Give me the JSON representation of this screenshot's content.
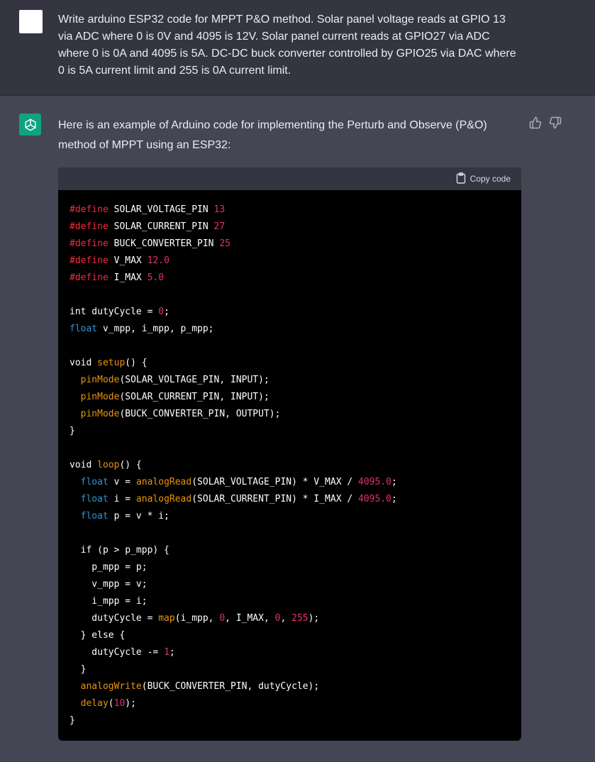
{
  "user": {
    "message": "Write arduino ESP32 code for MPPT P&O method. Solar panel voltage reads at GPIO 13 via ADC where 0 is 0V and 4095 is 12V. Solar panel current reads at GPIO27 via ADC where 0 is 0A and 4095 is 5A. DC-DC buck converter controlled by GPIO25 via DAC where 0 is 5A current limit and 255 is 0A current limit."
  },
  "assistant": {
    "intro": "Here is an example of Arduino code for implementing the Perturb and Observe (P&O) method of MPPT using an ESP32:",
    "avatar_icon": "openai-logo-icon",
    "feedback_icons": [
      "thumbs-up-icon",
      "thumbs-down-icon"
    ]
  },
  "code_block": {
    "copy_label": "Copy code",
    "copy_icon": "clipboard-icon",
    "lines": [
      [
        [
          "kw",
          "#define"
        ],
        [
          "p",
          " SOLAR_VOLTAGE_PIN "
        ],
        [
          "n",
          "13"
        ]
      ],
      [
        [
          "kw",
          "#define"
        ],
        [
          "p",
          " SOLAR_CURRENT_PIN "
        ],
        [
          "n",
          "27"
        ]
      ],
      [
        [
          "kw",
          "#define"
        ],
        [
          "p",
          " BUCK_CONVERTER_PIN "
        ],
        [
          "n",
          "25"
        ]
      ],
      [
        [
          "kw",
          "#define"
        ],
        [
          "p",
          " V_MAX "
        ],
        [
          "n",
          "12.0"
        ]
      ],
      [
        [
          "kw",
          "#define"
        ],
        [
          "p",
          " I_MAX "
        ],
        [
          "n",
          "5.0"
        ]
      ],
      [],
      [
        [
          "p",
          "int dutyCycle = "
        ],
        [
          "n",
          "0"
        ],
        [
          "p",
          ";"
        ]
      ],
      [
        [
          "t",
          "float"
        ],
        [
          "p",
          " v_mpp, i_mpp, p_mpp;"
        ]
      ],
      [],
      [
        [
          "p",
          "void "
        ],
        [
          "f",
          "setup"
        ],
        [
          "p",
          "() {"
        ]
      ],
      [
        [
          "p",
          "  "
        ],
        [
          "f",
          "pinMode"
        ],
        [
          "p",
          "(SOLAR_VOLTAGE_PIN, INPUT);"
        ]
      ],
      [
        [
          "p",
          "  "
        ],
        [
          "f",
          "pinMode"
        ],
        [
          "p",
          "(SOLAR_CURRENT_PIN, INPUT);"
        ]
      ],
      [
        [
          "p",
          "  "
        ],
        [
          "f",
          "pinMode"
        ],
        [
          "p",
          "(BUCK_CONVERTER_PIN, OUTPUT);"
        ]
      ],
      [
        [
          "p",
          "}"
        ]
      ],
      [],
      [
        [
          "p",
          "void "
        ],
        [
          "f",
          "loop"
        ],
        [
          "p",
          "() {"
        ]
      ],
      [
        [
          "p",
          "  "
        ],
        [
          "t",
          "float"
        ],
        [
          "p",
          " v = "
        ],
        [
          "f",
          "analogRead"
        ],
        [
          "p",
          "(SOLAR_VOLTAGE_PIN) * V_MAX / "
        ],
        [
          "n",
          "4095.0"
        ],
        [
          "p",
          ";"
        ]
      ],
      [
        [
          "p",
          "  "
        ],
        [
          "t",
          "float"
        ],
        [
          "p",
          " i = "
        ],
        [
          "f",
          "analogRead"
        ],
        [
          "p",
          "(SOLAR_CURRENT_PIN) * I_MAX / "
        ],
        [
          "n",
          "4095.0"
        ],
        [
          "p",
          ";"
        ]
      ],
      [
        [
          "p",
          "  "
        ],
        [
          "t",
          "float"
        ],
        [
          "p",
          " p = v * i;"
        ]
      ],
      [],
      [
        [
          "p",
          "  if (p > p_mpp) {"
        ]
      ],
      [
        [
          "p",
          "    p_mpp = p;"
        ]
      ],
      [
        [
          "p",
          "    v_mpp = v;"
        ]
      ],
      [
        [
          "p",
          "    i_mpp = i;"
        ]
      ],
      [
        [
          "p",
          "    dutyCycle = "
        ],
        [
          "f",
          "map"
        ],
        [
          "p",
          "(i_mpp, "
        ],
        [
          "n",
          "0"
        ],
        [
          "p",
          ", I_MAX, "
        ],
        [
          "n",
          "0"
        ],
        [
          "p",
          ", "
        ],
        [
          "n",
          "255"
        ],
        [
          "p",
          ");"
        ]
      ],
      [
        [
          "p",
          "  } else {"
        ]
      ],
      [
        [
          "p",
          "    dutyCycle -= "
        ],
        [
          "n",
          "1"
        ],
        [
          "p",
          ";"
        ]
      ],
      [
        [
          "p",
          "  }"
        ]
      ],
      [
        [
          "p",
          "  "
        ],
        [
          "f",
          "analogWrite"
        ],
        [
          "p",
          "(BUCK_CONVERTER_PIN, dutyCycle);"
        ]
      ],
      [
        [
          "p",
          "  "
        ],
        [
          "f",
          "delay"
        ],
        [
          "p",
          "("
        ],
        [
          "n",
          "10"
        ],
        [
          "p",
          ");"
        ]
      ],
      [
        [
          "p",
          "}"
        ]
      ]
    ]
  }
}
